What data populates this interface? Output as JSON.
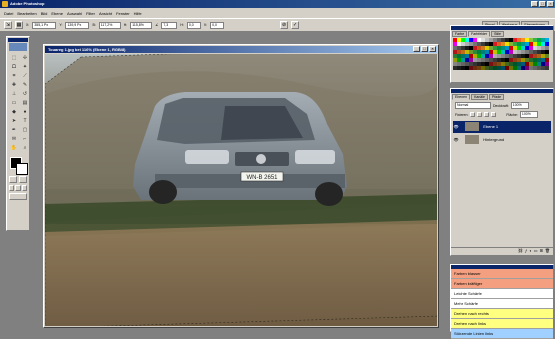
{
  "app": {
    "title": "Adobe Photoshop",
    "window_buttons": [
      "_",
      "□",
      "×"
    ]
  },
  "menu": [
    "Datei",
    "Bearbeiten",
    "Bild",
    "Ebene",
    "Auswahl",
    "Filter",
    "Ansicht",
    "Fenster",
    "Hilfe"
  ],
  "options": {
    "fields": [
      {
        "label": "X:",
        "value": "355,1 Px"
      },
      {
        "label": "Y:",
        "value": "139,9 Px"
      },
      {
        "label": "B:",
        "value": "117,2%"
      },
      {
        "label": "H:",
        "value": "115,8%"
      },
      {
        "label": "∠",
        "value": "7,3"
      },
      {
        "label": "H:",
        "value": "0,0"
      },
      {
        "label": "V:",
        "value": "0,0"
      }
    ],
    "commit_glyphs": [
      "⊘",
      "✓"
    ],
    "well_tabs": [
      "Pinsel",
      "Werkzeug",
      "Ebenenkomp."
    ]
  },
  "document": {
    "title": "Touareg 1.jpg bei 116% (Ebene 1, RGB/8)",
    "plate": "WN-B 2651"
  },
  "swatches_panel": {
    "tabs": [
      "Farbe",
      "Farbfelder",
      "Stile"
    ],
    "active": 1,
    "colors": [
      "#ff0000",
      "#ffff00",
      "#00ff00",
      "#00ffff",
      "#0000ff",
      "#ff00ff",
      "#ffffff",
      "#e0e0e0",
      "#c0c0c0",
      "#a0a0a0",
      "#808080",
      "#606060",
      "#404040",
      "#202020",
      "#000000",
      "#ed1c24",
      "#f26522",
      "#f7941d",
      "#fff200",
      "#8dc63f",
      "#39b54a",
      "#00a651",
      "#00a99d",
      "#00aeef"
    ]
  },
  "layers_panel": {
    "tabs": [
      "Ebenen",
      "Kanäle",
      "Pfade"
    ],
    "active": 0,
    "blend_mode": "Normal",
    "opacity_label": "Deckkraft:",
    "opacity_value": "100%",
    "lock_label": "Fixieren:",
    "fill_label": "Fläche:",
    "fill_value": "100%",
    "layers": [
      {
        "name": "Ebene 1",
        "selected": true
      },
      {
        "name": "Hintergrund",
        "selected": false
      }
    ]
  },
  "actions_panel": {
    "items": [
      {
        "label": "Farben blasser",
        "color": "#f4a080"
      },
      {
        "label": "Farben kräftiger",
        "color": "#f4a080"
      },
      {
        "label": "Leichte Schärfe",
        "color": "#ffffff"
      },
      {
        "label": "Mehr Schärfe",
        "color": "#ffffff"
      },
      {
        "label": "Drehen nach rechts",
        "color": "#ffff80"
      },
      {
        "label": "Drehen nach links",
        "color": "#ffff80"
      },
      {
        "label": "Stürzende Linien links",
        "color": "#a0d0ff"
      }
    ]
  }
}
